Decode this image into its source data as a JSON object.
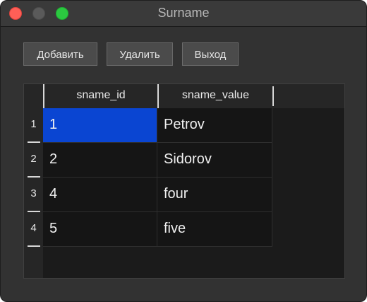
{
  "window": {
    "title": "Surname"
  },
  "toolbar": {
    "add_label": "Добавить",
    "delete_label": "Удалить",
    "exit_label": "Выход"
  },
  "table": {
    "columns": [
      "sname_id",
      "sname_value"
    ],
    "row_headers": [
      "1",
      "2",
      "3",
      "4"
    ],
    "rows": [
      [
        "1",
        "Petrov"
      ],
      [
        "2",
        "Sidorov"
      ],
      [
        "4",
        "four"
      ],
      [
        "5",
        "five"
      ]
    ],
    "selected_cell": "row 1, sname_id"
  },
  "colors": {
    "selection": "#0a45d2",
    "close": "#fe5f57",
    "maximize": "#2bc840"
  }
}
